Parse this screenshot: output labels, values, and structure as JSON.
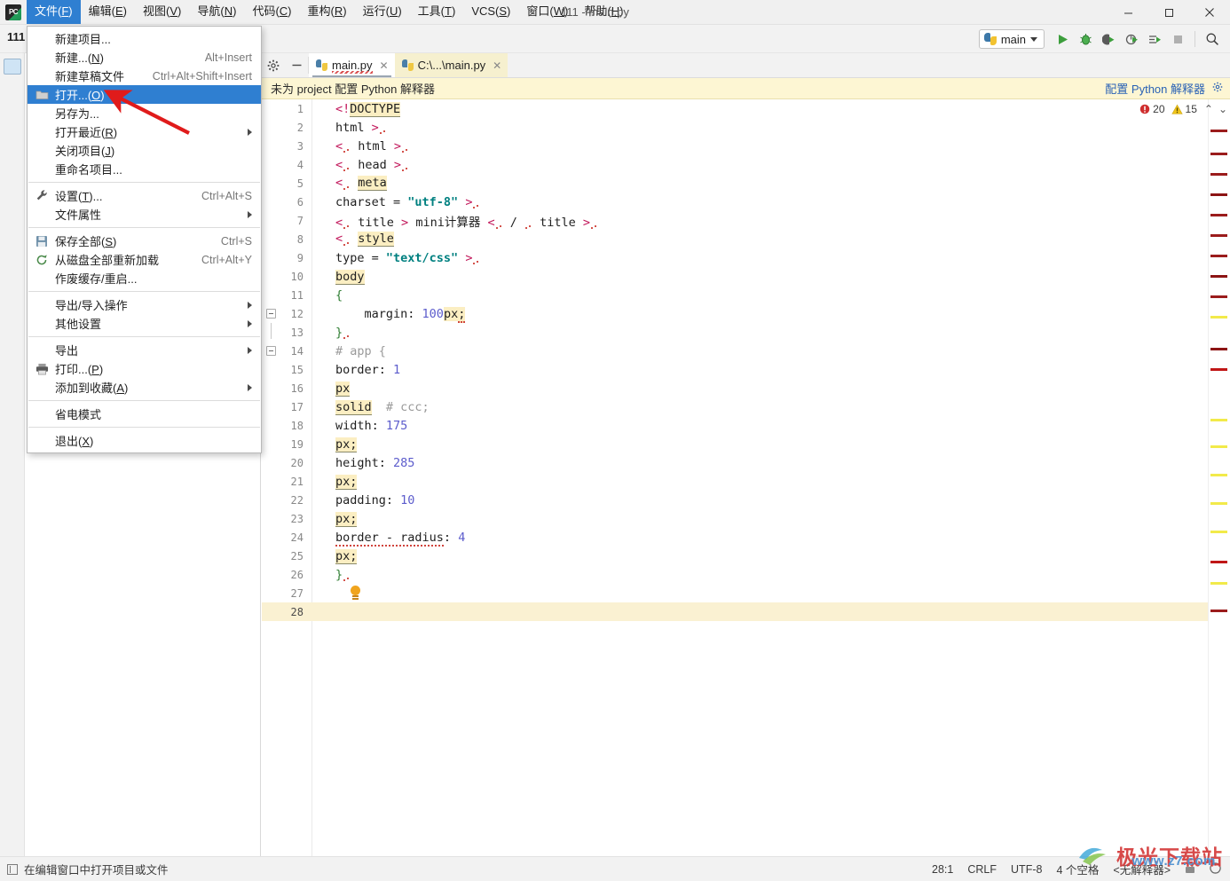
{
  "window": {
    "app_logo": "pycharm-logo-icon",
    "title": "111 - main.py",
    "minimize": "minimize-icon",
    "maximize": "maximize-icon",
    "close": "close-icon"
  },
  "menubar": [
    {
      "label": "文件(F)",
      "mnemonic": "F",
      "active": true
    },
    {
      "label": "编辑(E)",
      "mnemonic": "E",
      "active": false
    },
    {
      "label": "视图(V)",
      "mnemonic": "V",
      "active": false
    },
    {
      "label": "导航(N)",
      "mnemonic": "N",
      "active": false
    },
    {
      "label": "代码(C)",
      "mnemonic": "C",
      "active": false
    },
    {
      "label": "重构(R)",
      "mnemonic": "R",
      "active": false
    },
    {
      "label": "运行(U)",
      "mnemonic": "U",
      "active": false
    },
    {
      "label": "工具(T)",
      "mnemonic": "T",
      "active": false
    },
    {
      "label": "VCS(S)",
      "mnemonic": "S",
      "active": false
    },
    {
      "label": "窗口(W)",
      "mnemonic": "W",
      "active": false
    },
    {
      "label": "帮助(H)",
      "mnemonic": "H",
      "active": false
    }
  ],
  "file_menu": {
    "items": [
      {
        "label": "新建项目...",
        "shortcut": "",
        "icon": "",
        "submenu": false,
        "selected": false,
        "sep_after": false
      },
      {
        "label": "新建...(N)",
        "shortcut": "Alt+Insert",
        "icon": "",
        "submenu": false,
        "selected": false,
        "sep_after": false
      },
      {
        "label": "新建草稿文件",
        "shortcut": "Ctrl+Alt+Shift+Insert",
        "icon": "",
        "submenu": false,
        "selected": false,
        "sep_after": false
      },
      {
        "label": "打开...(O)",
        "shortcut": "",
        "icon": "folder-open-icon",
        "submenu": false,
        "selected": true,
        "sep_after": false
      },
      {
        "label": "另存为...",
        "shortcut": "",
        "icon": "",
        "submenu": false,
        "selected": false,
        "sep_after": false
      },
      {
        "label": "打开最近(R)",
        "shortcut": "",
        "icon": "",
        "submenu": true,
        "selected": false,
        "sep_after": false
      },
      {
        "label": "关闭项目(J)",
        "shortcut": "",
        "icon": "",
        "submenu": false,
        "selected": false,
        "sep_after": false
      },
      {
        "label": "重命名项目...",
        "shortcut": "",
        "icon": "",
        "submenu": false,
        "selected": false,
        "sep_after": true
      },
      {
        "label": "设置(T)...",
        "shortcut": "Ctrl+Alt+S",
        "icon": "wrench-icon",
        "submenu": false,
        "selected": false,
        "sep_after": false
      },
      {
        "label": "文件属性",
        "shortcut": "",
        "icon": "",
        "submenu": true,
        "selected": false,
        "sep_after": true
      },
      {
        "label": "保存全部(S)",
        "shortcut": "Ctrl+S",
        "icon": "save-icon",
        "submenu": false,
        "selected": false,
        "sep_after": false
      },
      {
        "label": "从磁盘全部重新加载",
        "shortcut": "Ctrl+Alt+Y",
        "icon": "refresh-icon",
        "submenu": false,
        "selected": false,
        "sep_after": false
      },
      {
        "label": "作废缓存/重启...",
        "shortcut": "",
        "icon": "",
        "submenu": false,
        "selected": false,
        "sep_after": true
      },
      {
        "label": "导出/导入操作",
        "shortcut": "",
        "icon": "",
        "submenu": true,
        "selected": false,
        "sep_after": false
      },
      {
        "label": "其他设置",
        "shortcut": "",
        "icon": "",
        "submenu": true,
        "selected": false,
        "sep_after": true
      },
      {
        "label": "导出",
        "shortcut": "",
        "icon": "",
        "submenu": true,
        "selected": false,
        "sep_after": false
      },
      {
        "label": "打印...(P)",
        "shortcut": "",
        "icon": "print-icon",
        "submenu": false,
        "selected": false,
        "sep_after": false
      },
      {
        "label": "添加到收藏(A)",
        "shortcut": "",
        "icon": "",
        "submenu": true,
        "selected": false,
        "sep_after": true
      },
      {
        "label": "省电模式",
        "shortcut": "",
        "icon": "",
        "submenu": false,
        "selected": false,
        "sep_after": true
      },
      {
        "label": "退出(X)",
        "shortcut": "",
        "icon": "",
        "submenu": false,
        "selected": false,
        "sep_after": false
      }
    ]
  },
  "project": {
    "name": "111",
    "tool_icon": "project-tool-icon",
    "settings_icon": "gear-icon",
    "hide_icon": "minimize-icon"
  },
  "toolbar": {
    "run_config": {
      "label": "main",
      "icon": "python-file-icon",
      "caret": "chevron-down-icon"
    },
    "buttons": [
      {
        "name": "run-button",
        "icon": "play-icon"
      },
      {
        "name": "debug-button",
        "icon": "bug-icon"
      },
      {
        "name": "run-coverage-button",
        "icon": "coverage-icon"
      },
      {
        "name": "profile-button",
        "icon": "profile-icon"
      },
      {
        "name": "run-with-console-button",
        "icon": "console-run-icon"
      },
      {
        "name": "stop-button",
        "icon": "stop-icon"
      },
      {
        "name": "search-everywhere-button",
        "icon": "search-icon"
      }
    ]
  },
  "editor": {
    "tabs": [
      {
        "label": "main.py",
        "icon": "python-file-icon",
        "close": "close-icon",
        "active": true,
        "error": true
      },
      {
        "label": "C:\\...\\main.py",
        "icon": "python-file-icon",
        "close": "close-icon",
        "active": false,
        "error": false
      }
    ],
    "notification": {
      "message": "未为 project 配置 Python 解释器",
      "link": "配置 Python 解释器",
      "gear": "gear-icon"
    },
    "inspection": {
      "error_icon": "error-icon",
      "error_count": "20",
      "warning_icon": "warning-icon",
      "warning_count": "15",
      "prev_icon": "chevron-up-icon",
      "next_icon": "chevron-down-icon"
    },
    "current_line": 28,
    "total_lines": 28,
    "lines": [
      {
        "n": 1,
        "html": "<span class=\"ang\">&lt;!</span><span class=\"hl ul\">DOCTYPE</span>"
      },
      {
        "n": 2,
        "html": "html <span class=\"ang\">&gt;</span><span class=\"wav\"></span>"
      },
      {
        "n": 3,
        "html": "<span class=\"ang\">&lt;</span><span class=\"wav\"></span> html <span class=\"ang\">&gt;</span><span class=\"wav\"></span>"
      },
      {
        "n": 4,
        "html": "<span class=\"ang\">&lt;</span><span class=\"wav\"></span> head <span class=\"ang\">&gt;</span><span class=\"wav\"></span>"
      },
      {
        "n": 5,
        "html": "<span class=\"ang\">&lt;</span><span class=\"wav\"></span> <span class=\"hl ul\">meta</span>"
      },
      {
        "n": 6,
        "html": "charset = <span class=\"str\">\"utf-8\"</span> <span class=\"ang\">&gt;</span><span class=\"wav\"></span>"
      },
      {
        "n": 7,
        "html": "<span class=\"ang\">&lt;</span><span class=\"wav\"></span> title <span class=\"ang\">&gt;</span> mini计算器 <span class=\"ang\">&lt;</span><span class=\"wav\"></span> / <span class=\"wav\"></span> title <span class=\"ang\">&gt;</span><span class=\"wav\"></span>"
      },
      {
        "n": 8,
        "html": "<span class=\"ang\">&lt;</span><span class=\"wav\"></span> <span class=\"hl ul\">style</span>"
      },
      {
        "n": 9,
        "html": "type = <span class=\"str\">\"text/css\"</span> <span class=\"ang\">&gt;</span><span class=\"wav\"></span>"
      },
      {
        "n": 10,
        "html": "<span class=\"hl ul\">body</span>"
      },
      {
        "n": 11,
        "html": "<span class=\"brc\">{</span>"
      },
      {
        "n": 12,
        "html": "    margin: <span class=\"num\">100</span><span class=\"hl\">px</span><span class=\"hl sq\">;</span>"
      },
      {
        "n": 13,
        "html": "<span class=\"brc\">}</span><span class=\"wav\"></span>"
      },
      {
        "n": 14,
        "html": "<span class=\"cmt\"># app {</span>"
      },
      {
        "n": 15,
        "html": "border: <span class=\"num\">1</span>"
      },
      {
        "n": 16,
        "html": "<span class=\"hl ul\">px</span>"
      },
      {
        "n": 17,
        "html": "<span class=\"hl ul\">solid</span>  <span class=\"cmt\"># ccc;</span>"
      },
      {
        "n": 18,
        "html": "width: <span class=\"num\">175</span>"
      },
      {
        "n": 19,
        "html": "<span class=\"hl ul\">px;</span>"
      },
      {
        "n": 20,
        "html": "height: <span class=\"num\">285</span>"
      },
      {
        "n": 21,
        "html": "<span class=\"hl ul\">px;</span>"
      },
      {
        "n": 22,
        "html": "padding: <span class=\"num\">10</span>"
      },
      {
        "n": 23,
        "html": "<span class=\"hl ul\">px;</span>"
      },
      {
        "n": 24,
        "html": "<span class=\"sq\">border - radius</span>: <span class=\"num\">4</span>"
      },
      {
        "n": 25,
        "html": "<span class=\"hl ul\">px;</span>"
      },
      {
        "n": 26,
        "html": "<span class=\"brc\">}</span><span class=\"wav\"></span>"
      },
      {
        "n": 27,
        "html": "  <span class=\"bulb\"></span>"
      },
      {
        "n": 28,
        "html": ""
      }
    ]
  },
  "statusbar": {
    "hint_icon": "editor-window-icon",
    "hint": "在编辑窗口中打开项目或文件",
    "caret": "28:1",
    "line_separator": "CRLF",
    "encoding": "UTF-8",
    "indent": "4 个空格",
    "interpreter": "<无解释器>",
    "lock_icon": "lock-icon",
    "memory_icon": "memory-indicator-icon"
  },
  "watermark": {
    "title": "极光下载站",
    "url": "www.z7.com"
  },
  "colors": {
    "accent_blue": "#2f7fd1",
    "notice_bg": "#fdf6d3",
    "error_red": "#d94f4f",
    "warning_yellow": "#f0c419",
    "run_green": "#3c9e3c",
    "current_line": "#faf1d2"
  }
}
